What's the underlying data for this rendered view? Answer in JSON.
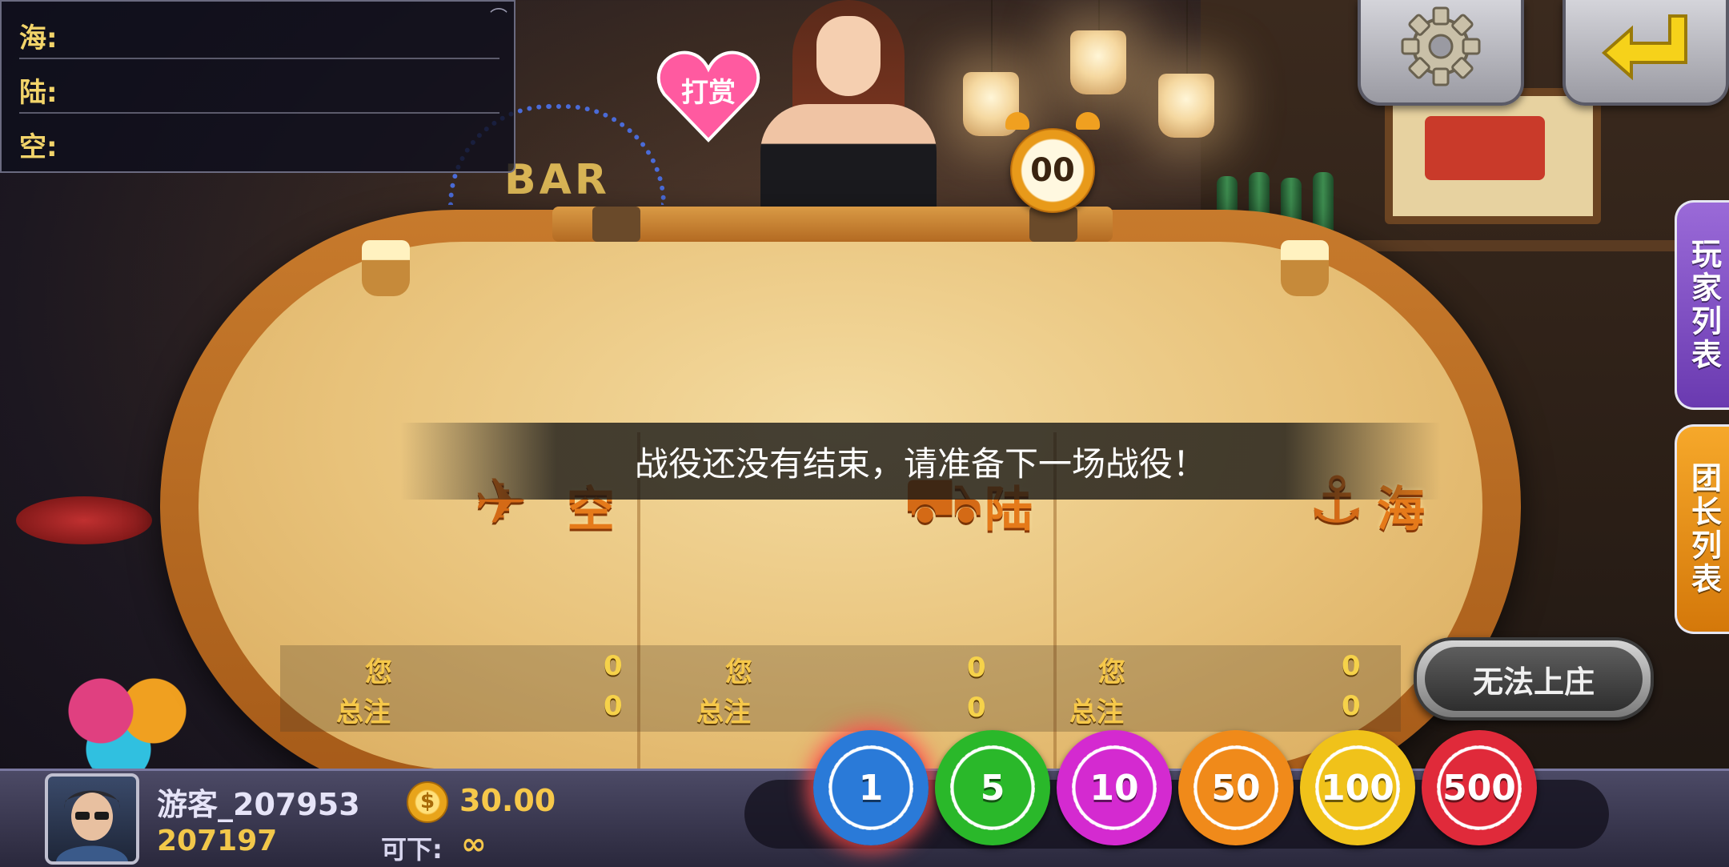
{
  "panel": {
    "rows": [
      {
        "label": "海:"
      },
      {
        "label": "陆:"
      },
      {
        "label": "空:"
      }
    ]
  },
  "reward": {
    "label": "打赏"
  },
  "timer": {
    "value": "00"
  },
  "message": "战役还没有结束，请准备下一场战役！",
  "zones": [
    {
      "label": "空",
      "icon": "airplane-icon"
    },
    {
      "label": "陆",
      "icon": "tank-icon"
    },
    {
      "label": "海",
      "icon": "anchor-icon"
    }
  ],
  "stats": [
    {
      "you_label": "您",
      "you_value": "0",
      "total_label": "总注",
      "total_value": "0"
    },
    {
      "you_label": "您",
      "you_value": "0",
      "total_label": "总注",
      "total_value": "0"
    },
    {
      "you_label": "您",
      "you_value": "0",
      "total_label": "总注",
      "total_value": "0"
    }
  ],
  "side_tabs": {
    "players": "玩家列表",
    "leaders": "团长列表"
  },
  "banker_button": "无法上庄",
  "player": {
    "name": "游客_207953",
    "id": "207197",
    "coins": "30.00",
    "can_bet_label": "可下:",
    "can_bet_value": "∞"
  },
  "chips": [
    {
      "value": "1",
      "color": "#2a7ad8",
      "selected": true
    },
    {
      "value": "5",
      "color": "#2ab82a"
    },
    {
      "value": "10",
      "color": "#d42ad0"
    },
    {
      "value": "50",
      "color": "#f08a1a"
    },
    {
      "value": "100",
      "color": "#f0c21a"
    },
    {
      "value": "500",
      "color": "#e02a3a"
    }
  ],
  "colors": {
    "accent": "#f6c84a",
    "table": "#e8c27a",
    "zone_text": "#e57a1a"
  }
}
